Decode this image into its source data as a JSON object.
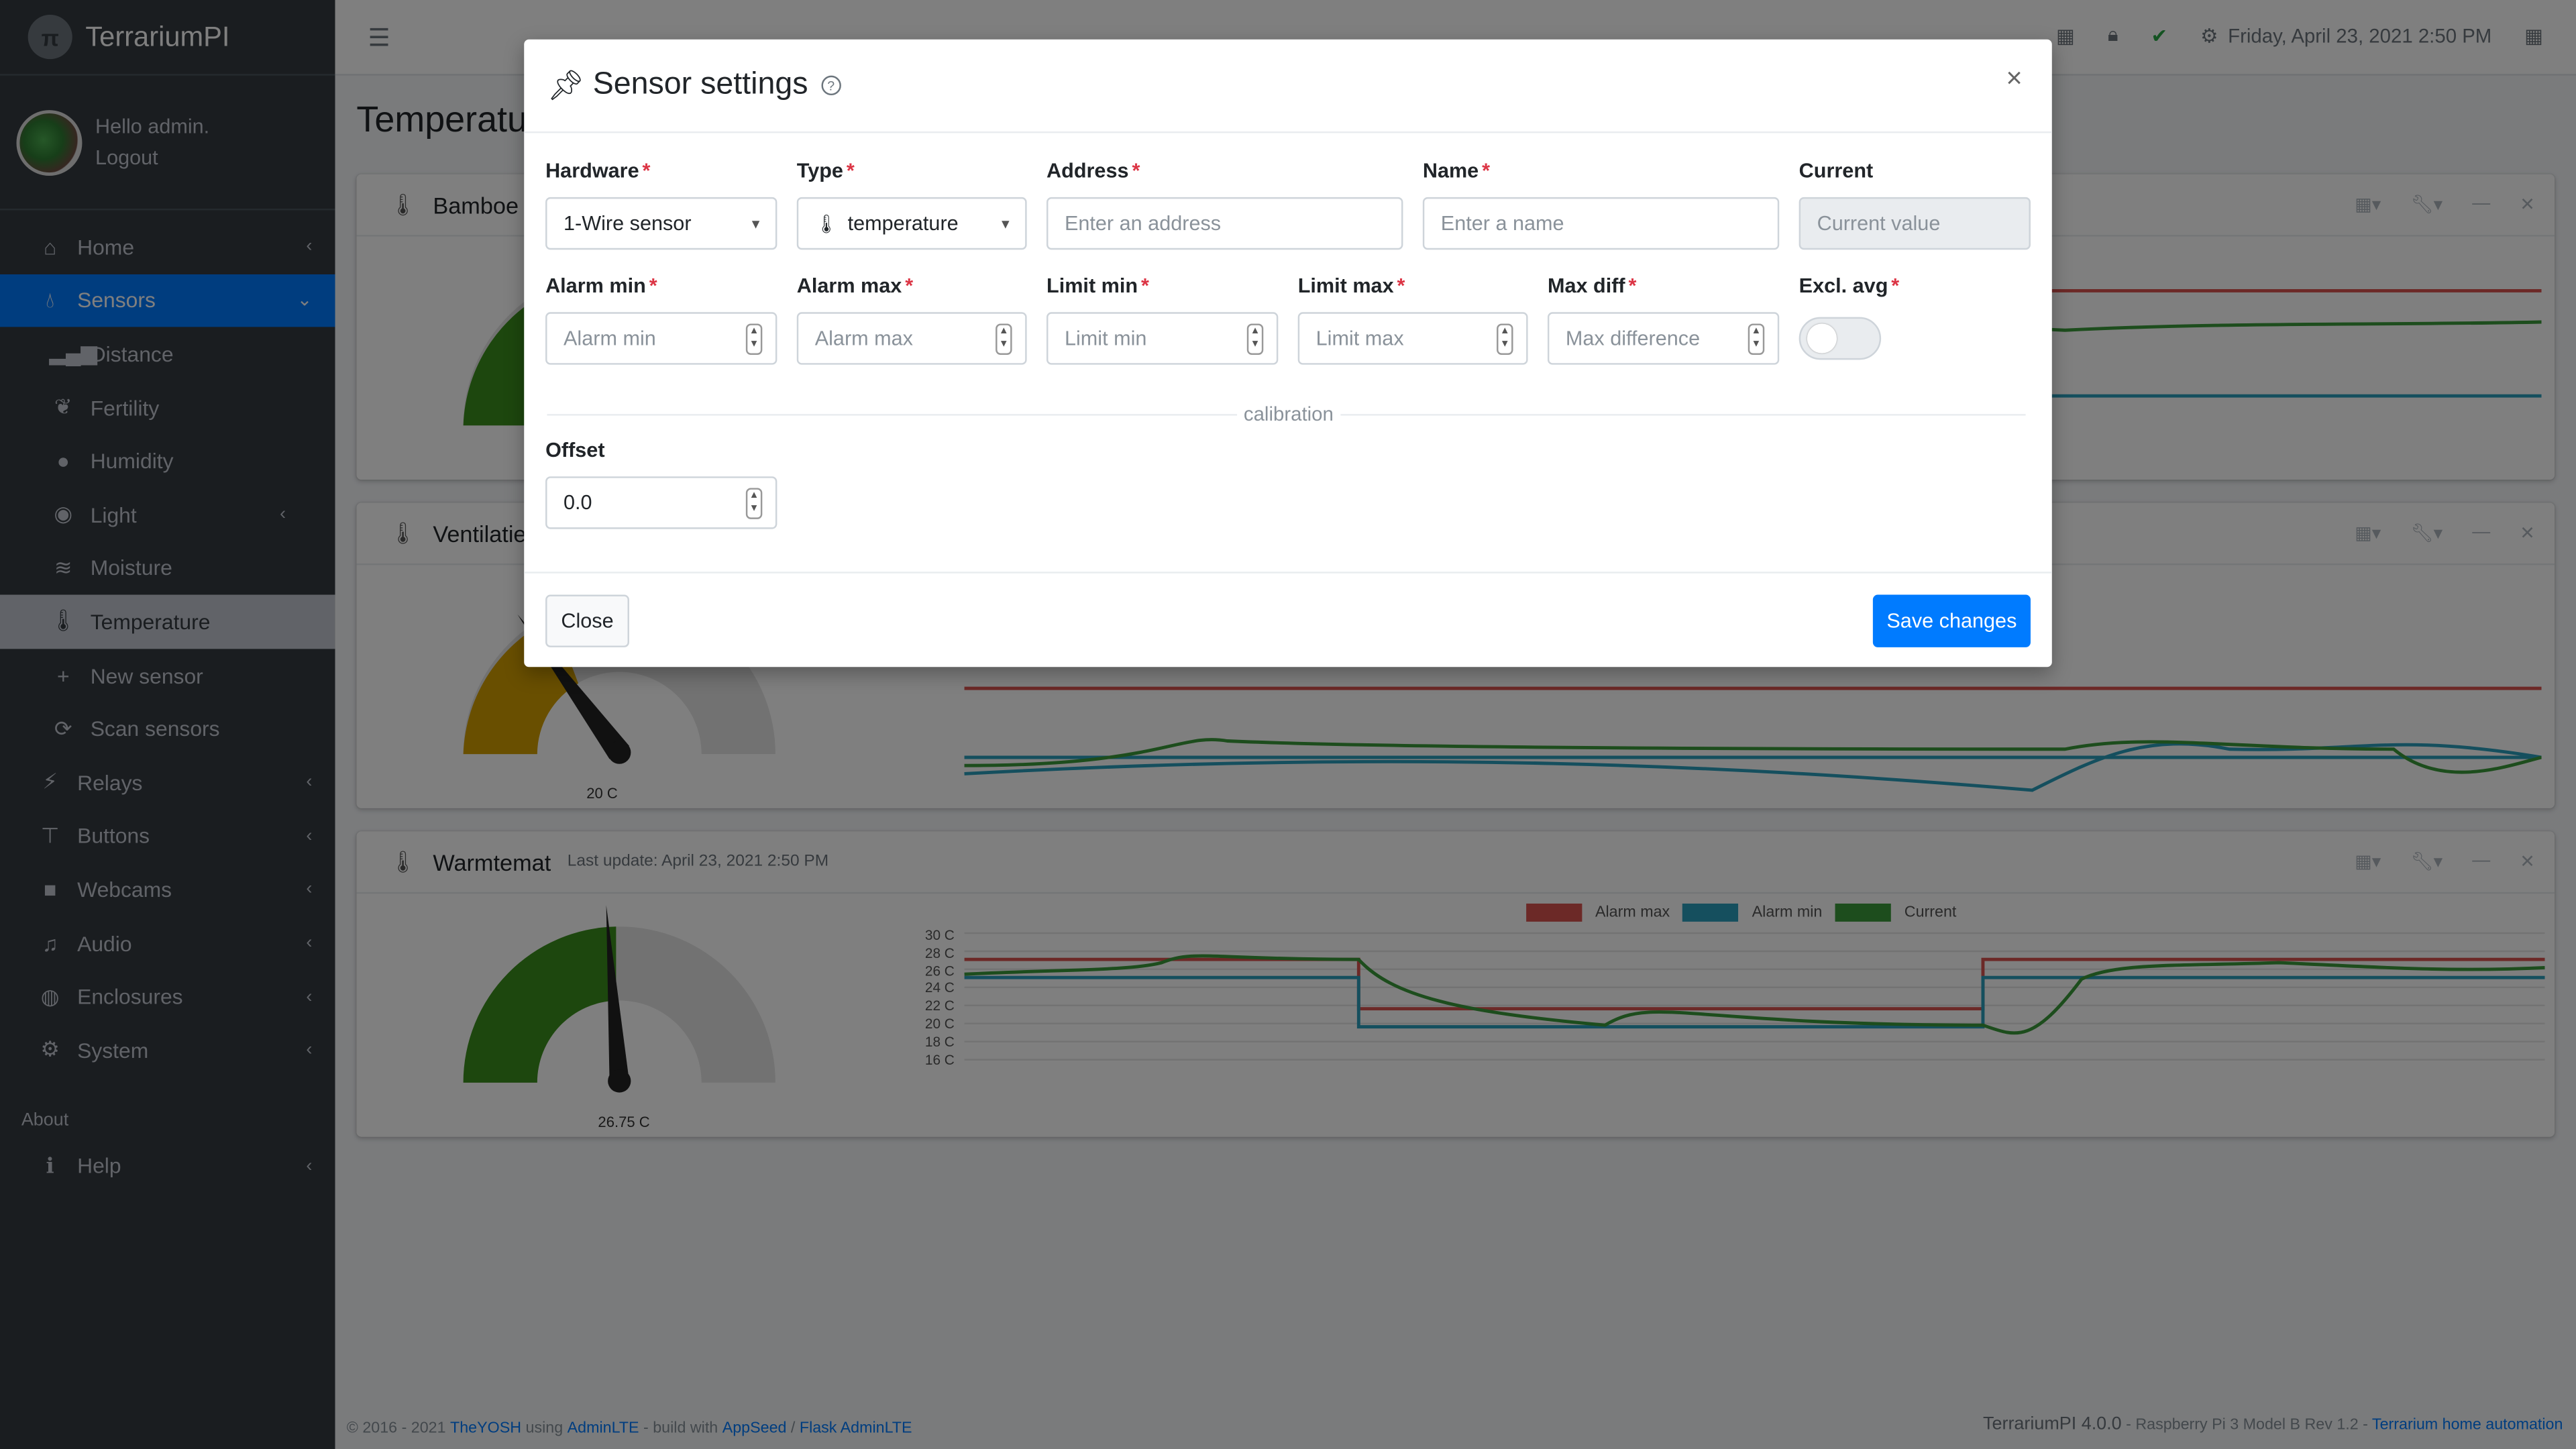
{
  "brand": {
    "name": "TerrariumPI"
  },
  "user": {
    "greeting": "Hello admin.",
    "logout": "Logout"
  },
  "nav": {
    "home": "Home",
    "sensors": "Sensors",
    "distance": "Distance",
    "fertility": "Fertility",
    "humidity": "Humidity",
    "light": "Light",
    "moisture": "Moisture",
    "temperature": "Temperature",
    "new_sensor": "New sensor",
    "scan_sensors": "Scan sensors",
    "relays": "Relays",
    "buttons": "Buttons",
    "webcams": "Webcams",
    "audio": "Audio",
    "enclosures": "Enclosures",
    "system": "System",
    "about_header": "About",
    "help": "Help"
  },
  "topbar": {
    "datetime": "Friday, April 23, 2021 2:50 PM"
  },
  "page": {
    "title": "Temperature"
  },
  "cards": [
    {
      "name": "Bamboe"
    },
    {
      "name": "Ventilatie"
    },
    {
      "name": "Warmtemat",
      "last_update": "Last update: April 23, 2021 2:50 PM"
    }
  ],
  "gauges": {
    "ventilatie_value": "20 C",
    "warmtemat_value": "26.75 C"
  },
  "chart_legend": {
    "alarm_max": "Alarm max",
    "alarm_min": "Alarm min",
    "current": "Current"
  },
  "chart_yticks": [
    "30 C",
    "28 C",
    "26 C",
    "24 C",
    "22 C",
    "20 C",
    "18 C",
    "16 C"
  ],
  "colors": {
    "alarm_max": "#d9534f",
    "alarm_min": "#2a9fbc",
    "current": "#3a9a3a",
    "primary": "#007bff"
  },
  "modal": {
    "title": "Sensor settings",
    "labels": {
      "hardware": "Hardware",
      "type": "Type",
      "address": "Address",
      "name": "Name",
      "current": "Current",
      "alarm_min": "Alarm min",
      "alarm_max": "Alarm max",
      "limit_min": "Limit min",
      "limit_max": "Limit max",
      "max_diff": "Max diff",
      "excl_avg": "Excl. avg",
      "offset": "Offset",
      "calibration": "calibration"
    },
    "values": {
      "hardware": "1-Wire sensor",
      "type": "temperature",
      "offset": "0.0"
    },
    "placeholders": {
      "address": "Enter an address",
      "name": "Enter a name",
      "current": "Current value",
      "alarm_min": "Alarm min",
      "alarm_max": "Alarm max",
      "limit_min": "Limit min",
      "limit_max": "Limit max",
      "max_diff": "Max difference"
    },
    "buttons": {
      "close": "Close",
      "save": "Save changes"
    }
  },
  "footer": {
    "copyright": "© 2016 - 2021",
    "author": "TheYOSH",
    "using": "using",
    "adminlte": "AdminLTE",
    "build": "- build with",
    "appseed": "AppSeed",
    "slash": "/",
    "flask": "Flask AdminLTE",
    "version": "TerrariumPI 4.0.0",
    "hardware": "- Raspberry Pi 3 Model B Rev 1.2 -",
    "home_link": "Terrarium home automation"
  }
}
